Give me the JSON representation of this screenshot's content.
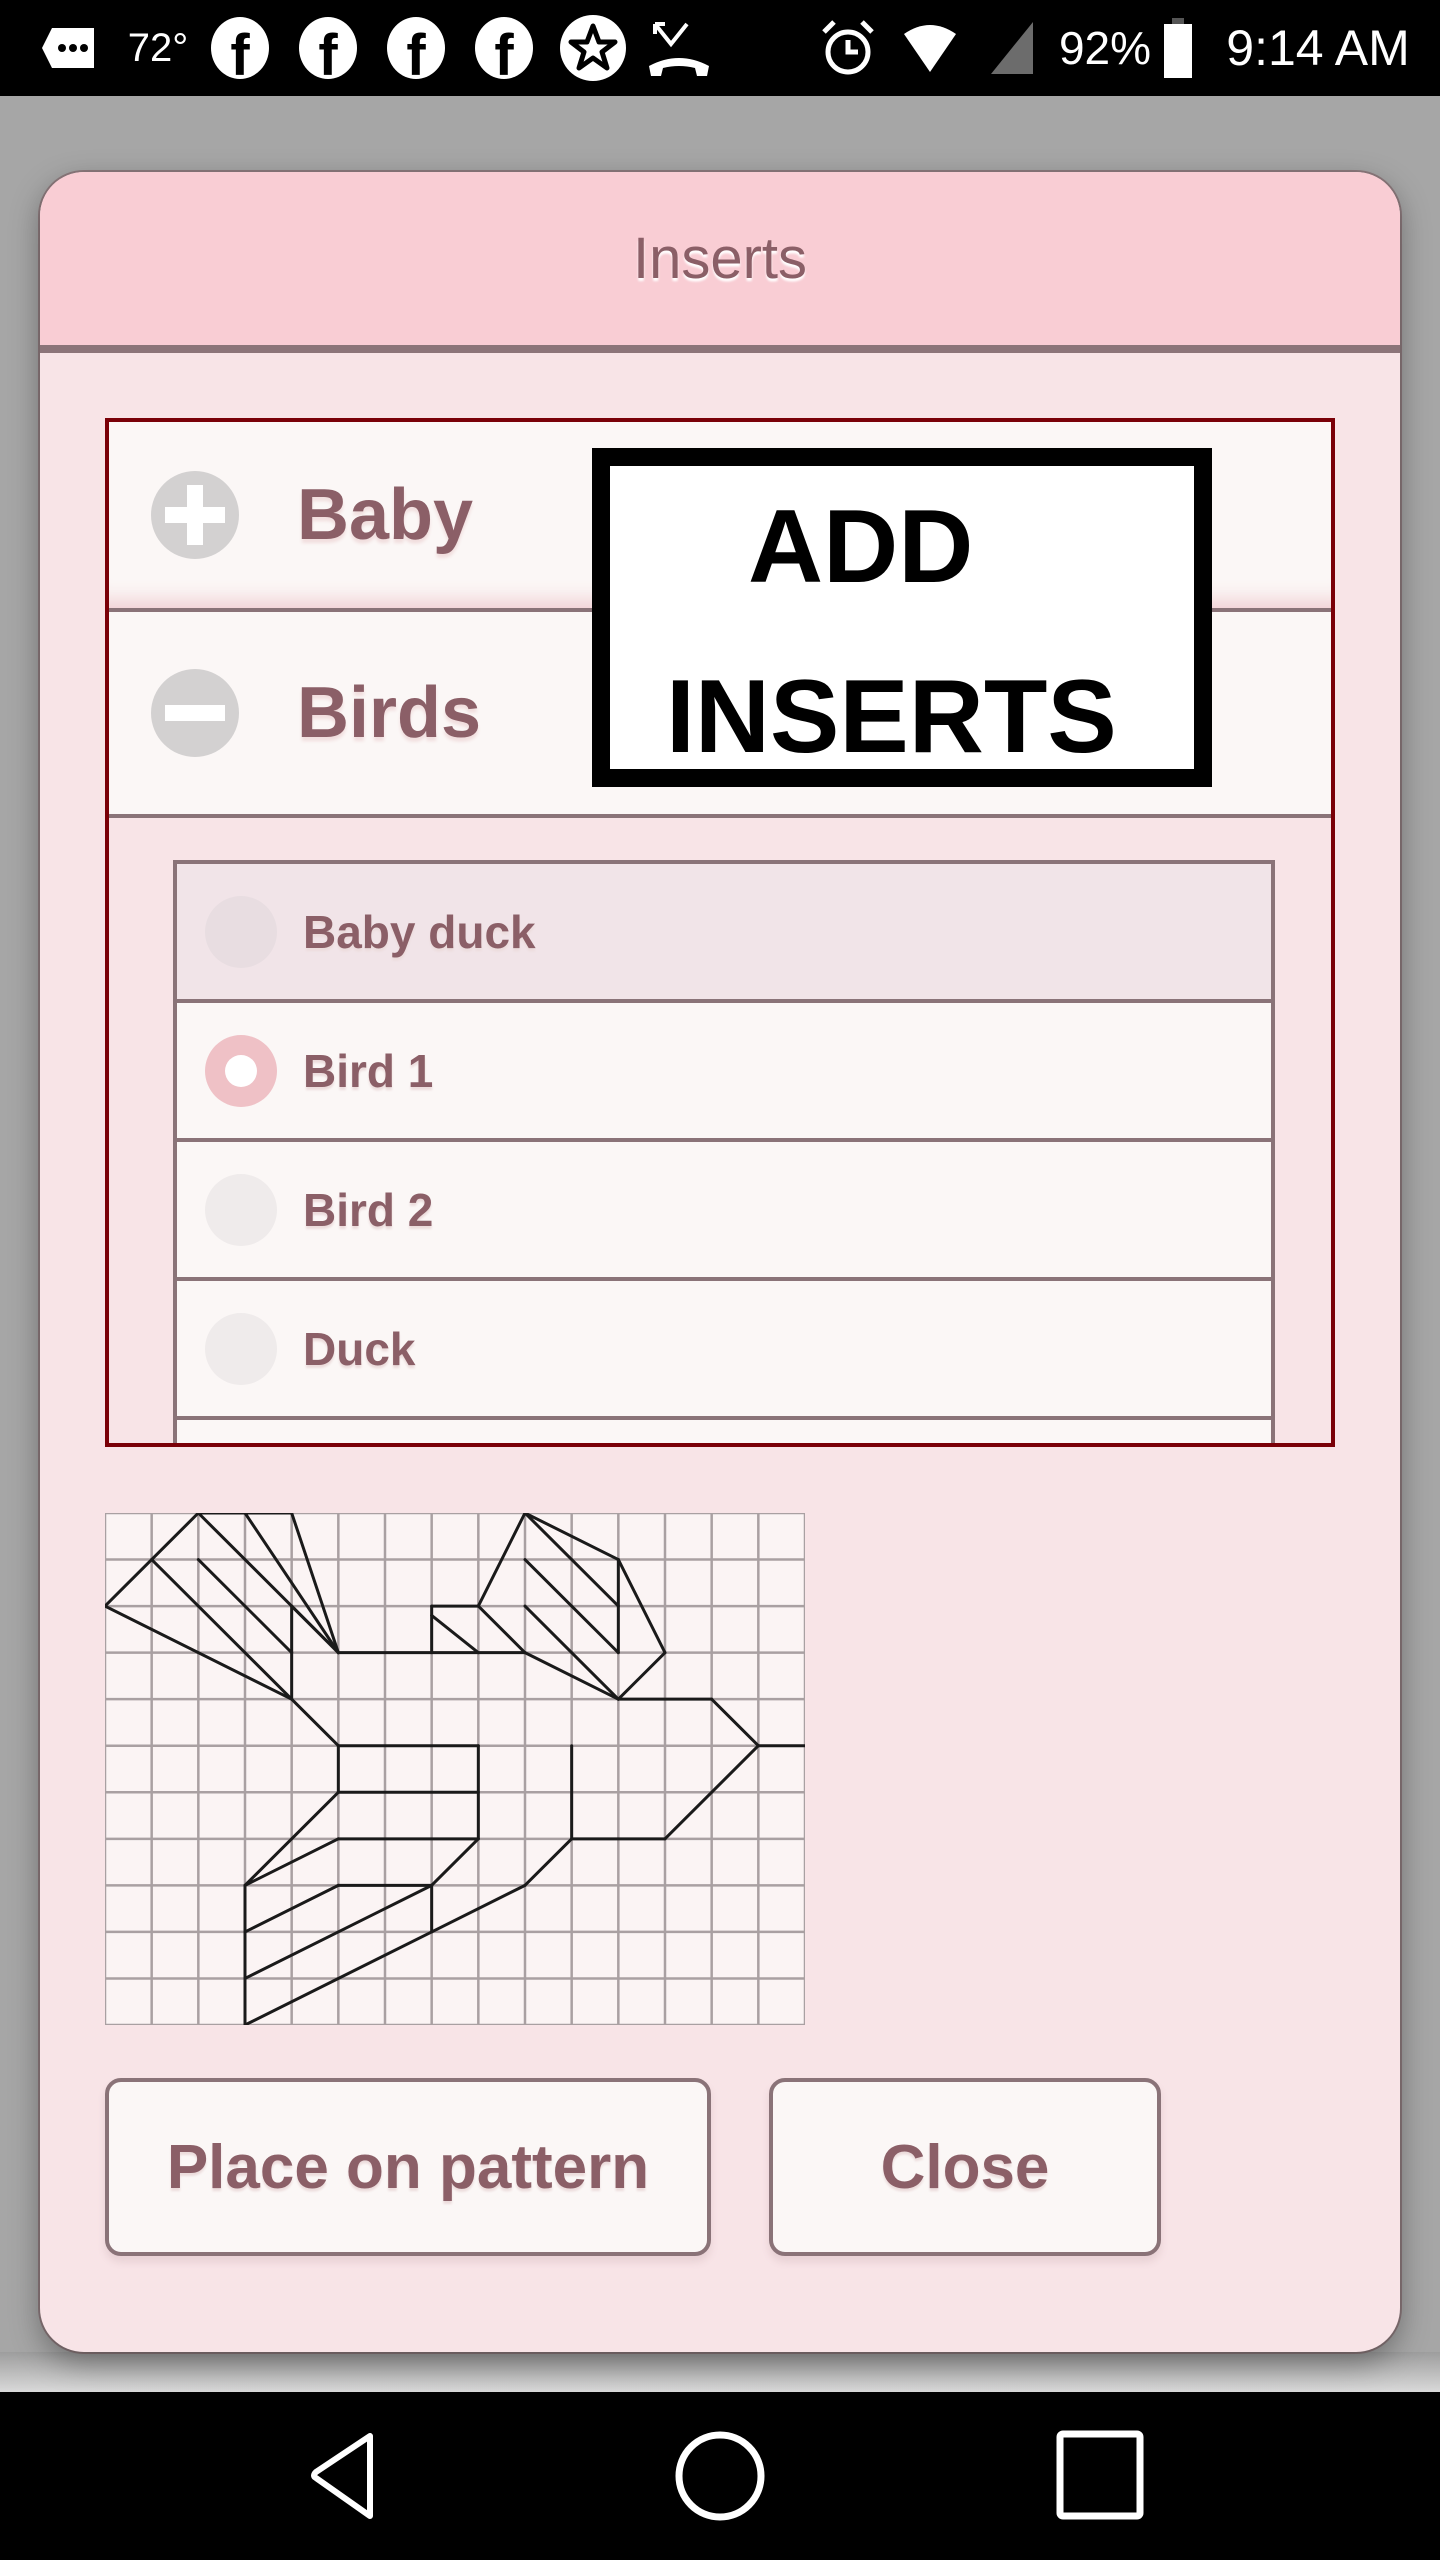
{
  "status_bar": {
    "temperature": "72°",
    "notification_icons": [
      "messages-icon",
      "facebook-icon",
      "facebook-icon",
      "facebook-icon",
      "facebook-icon",
      "star-app-icon",
      "missed-call-icon"
    ],
    "system_icons": [
      "alarm-icon",
      "wifi-icon",
      "cell-signal-icon",
      "battery-icon"
    ],
    "battery": "92%",
    "time": "9:14 AM"
  },
  "dialog": {
    "title": "Inserts",
    "categories": [
      {
        "label": "Baby",
        "expanded": false,
        "icon": "plus-icon"
      },
      {
        "label": "Birds",
        "expanded": true,
        "icon": "minus-icon"
      }
    ],
    "items": [
      {
        "label": "Baby duck",
        "selected": false,
        "highlighted": true
      },
      {
        "label": "Bird 1",
        "selected": true,
        "highlighted": false
      },
      {
        "label": "Bird 2",
        "selected": false,
        "highlighted": false
      },
      {
        "label": "Duck",
        "selected": false,
        "highlighted": false
      }
    ],
    "preview": {
      "description": "Bird 1 insert pattern preview",
      "grid_cols": 15,
      "grid_rows": 11,
      "segments": [
        [
          0,
          2,
          1,
          1
        ],
        [
          1,
          1,
          2,
          0
        ],
        [
          2,
          0,
          4,
          0
        ],
        [
          0,
          2,
          4,
          4
        ],
        [
          1,
          1,
          4,
          4
        ],
        [
          2,
          1,
          4,
          3
        ],
        [
          2,
          0,
          5,
          3
        ],
        [
          3,
          0,
          5,
          3
        ],
        [
          4,
          0,
          5,
          3
        ],
        [
          4,
          2,
          4,
          4
        ],
        [
          4,
          2,
          5,
          3
        ],
        [
          5,
          3,
          9,
          3
        ],
        [
          7,
          2,
          7,
          3
        ],
        [
          7,
          2,
          8,
          2
        ],
        [
          7,
          2.2,
          8,
          3
        ],
        [
          8,
          2,
          9,
          0
        ],
        [
          8,
          2,
          9,
          3
        ],
        [
          9,
          0,
          11,
          1
        ],
        [
          9,
          0,
          11,
          2
        ],
        [
          9,
          1,
          11,
          3
        ],
        [
          9,
          2,
          11,
          4
        ],
        [
          11,
          1,
          11,
          3
        ],
        [
          11,
          1,
          12,
          3
        ],
        [
          12,
          3,
          11,
          4
        ],
        [
          9,
          3,
          11,
          4
        ],
        [
          11,
          4,
          13,
          4
        ],
        [
          13,
          4,
          14,
          5
        ],
        [
          14,
          5,
          15,
          5
        ],
        [
          14,
          5,
          12,
          7
        ],
        [
          12,
          7,
          10,
          7
        ],
        [
          10,
          5,
          10,
          7
        ],
        [
          4,
          4,
          5,
          5
        ],
        [
          5,
          5,
          8,
          5
        ],
        [
          8,
          5,
          8,
          7
        ],
        [
          5,
          5,
          5,
          6
        ],
        [
          5,
          6,
          8,
          6
        ],
        [
          5,
          6,
          3,
          8
        ],
        [
          3,
          8,
          5,
          7
        ],
        [
          5,
          7,
          8,
          7
        ],
        [
          8,
          7,
          7,
          8
        ],
        [
          7,
          8,
          5,
          8
        ],
        [
          5,
          8,
          3,
          9
        ],
        [
          3,
          8,
          3,
          11
        ],
        [
          3,
          10,
          7,
          8
        ],
        [
          7,
          8,
          7,
          9
        ],
        [
          3,
          11,
          7,
          9
        ],
        [
          7,
          9,
          9,
          8
        ],
        [
          9,
          8,
          10,
          7
        ]
      ]
    },
    "buttons": {
      "place": "Place on pattern",
      "close": "Close"
    }
  },
  "overlay": {
    "line1": "ADD",
    "line2": "INSERTS"
  },
  "nav_bar": {
    "buttons": [
      "back",
      "home",
      "recents"
    ]
  },
  "colors": {
    "accent_text": "#8b5f67",
    "header_bg": "#f9cdd4",
    "body_bg": "#f8e4e7",
    "border_dark_red": "#7a0008",
    "selected_radio": "#efc1c6"
  }
}
